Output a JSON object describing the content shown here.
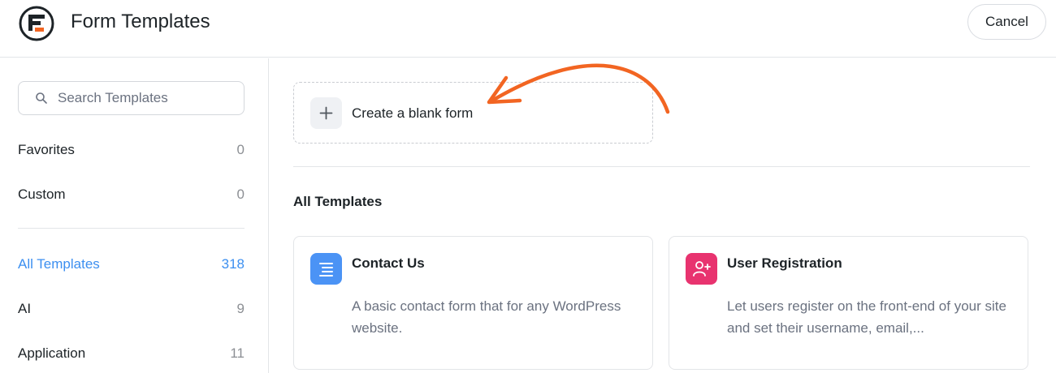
{
  "header": {
    "title": "Form Templates",
    "logo_icon": "fluent-forms-logo",
    "cancel_label": "Cancel"
  },
  "sidebar": {
    "search": {
      "placeholder": "Search Templates",
      "value": ""
    },
    "items": [
      {
        "label": "Favorites",
        "count": "0",
        "active": false
      },
      {
        "label": "Custom",
        "count": "0",
        "active": false
      },
      {
        "label": "All Templates",
        "count": "318",
        "active": true
      },
      {
        "label": "AI",
        "count": "9",
        "active": false
      },
      {
        "label": "Application",
        "count": "11",
        "active": false
      }
    ]
  },
  "main": {
    "blank_form_label": "Create a blank form",
    "section_title": "All Templates",
    "templates": [
      {
        "name": "Contact Us",
        "description": "A basic contact form that for any WordPress website.",
        "icon": "list-lines-icon",
        "icon_color": "#4b93f5"
      },
      {
        "name": "User Registration",
        "description": "Let users register on the front-end of your site and set their username, email,...",
        "icon": "user-plus-icon",
        "icon_color": "#e8336f"
      }
    ]
  },
  "colors": {
    "accent": "#3c8ff0",
    "annotation_arrow": "#f26522",
    "logo_mark": "#1d2327",
    "logo_accent": "#f26522"
  }
}
